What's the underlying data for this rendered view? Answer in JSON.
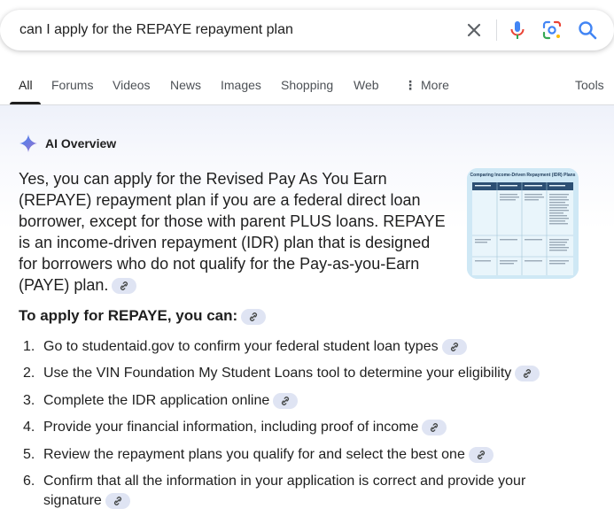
{
  "search": {
    "query": "can I apply for the REPAYE repayment plan"
  },
  "tabs": [
    {
      "label": "All"
    },
    {
      "label": "Forums"
    },
    {
      "label": "Videos"
    },
    {
      "label": "News"
    },
    {
      "label": "Images"
    },
    {
      "label": "Shopping"
    },
    {
      "label": "Web"
    },
    {
      "label": "More"
    },
    {
      "label": "Tools"
    }
  ],
  "overview": {
    "label": "AI Overview",
    "summary": "Yes, you can apply for the Revised Pay As You Earn (REPAYE) repayment plan if you are a federal direct loan borrower, except for those with parent PLUS loans. REPAYE is an income-driven repayment (IDR) plan that is designed for borrowers who do not qualify for the Pay-as-you-Earn (PAYE) plan.",
    "thumbnail_title": "Comparing Income-Driven Repayment (IDR) Plans",
    "subheading": "To apply for REPAYE, you can:",
    "steps": [
      {
        "num": "1.",
        "text": "Go to studentaid.gov to confirm your federal student loan types"
      },
      {
        "num": "2.",
        "text": "Use the VIN Foundation My Student Loans tool to determine your eligibility"
      },
      {
        "num": "3.",
        "text": "Complete the IDR application online"
      },
      {
        "num": "4.",
        "text": "Provide your financial information, including proof of income"
      },
      {
        "num": "5.",
        "text": "Review the repayment plans you qualify for and select the best one"
      },
      {
        "num": "6.",
        "text": "Confirm that all the information in your application is correct and provide your signature"
      }
    ]
  },
  "colors": {
    "accent_blue": "#4285f4",
    "mic_red": "#ea4335",
    "chip_bg": "#dfe4f3",
    "tab_text": "#4d5156"
  }
}
